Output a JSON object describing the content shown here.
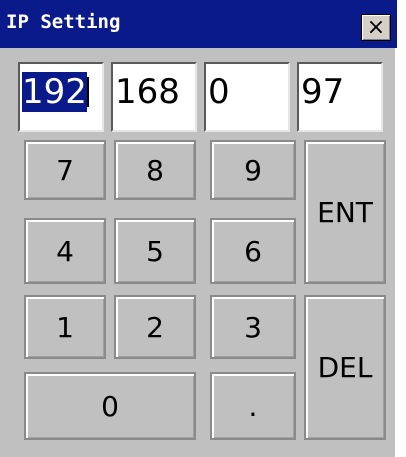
{
  "window": {
    "title": "IP Setting",
    "close_glyph": "×"
  },
  "ip": {
    "octet1": "192",
    "octet2": "168",
    "octet3": "0",
    "octet4": "97"
  },
  "keypad": {
    "k7": "7",
    "k8": "8",
    "k9": "9",
    "k4": "4",
    "k5": "5",
    "k6": "6",
    "k1": "1",
    "k2": "2",
    "k3": "3",
    "k0": "0",
    "dot": ".",
    "enter": "ENT",
    "delete": "DEL"
  },
  "colors": {
    "titlebar": "#0a1a8a",
    "window_bg": "#c0c0c0",
    "selection": "#0a1a8a"
  }
}
